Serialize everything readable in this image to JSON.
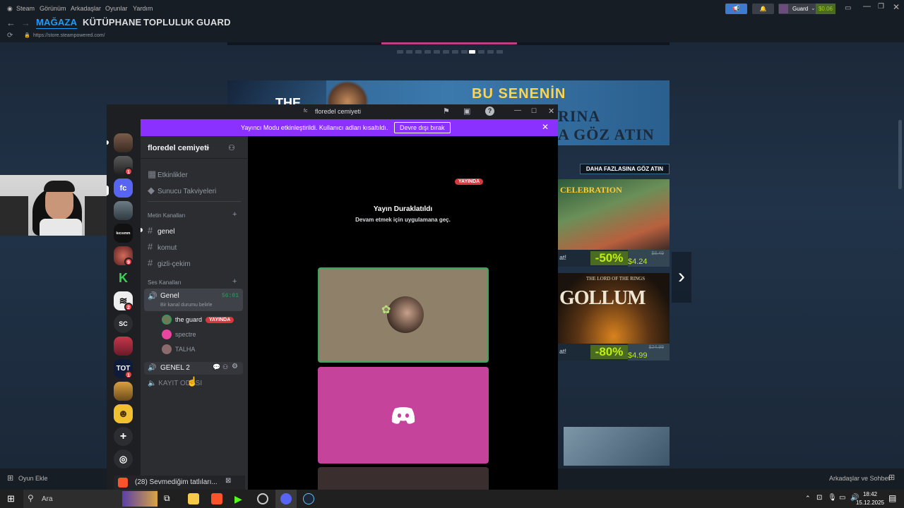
{
  "steam": {
    "menu": [
      "Steam",
      "Görünüm",
      "Arkadaşlar",
      "Oyunlar",
      "Yardım"
    ],
    "user_name": "Guard",
    "wallet": "$0.06",
    "tabs": [
      "MAĞAZA",
      "KÜTÜPHANE",
      "TOPLULUK",
      "GUARD"
    ],
    "url": "https://store.steampowered.com/",
    "banner_line1": "BU SENENİN",
    "banner_line2": "RINA",
    "banner_line3": "A GÖZ ATIN",
    "banner_left": "THE",
    "more_button": "DAHA FAZLASINA GÖZ ATIN",
    "cards": [
      {
        "title": "CELEBRATION",
        "label": "at!",
        "discount": "-50%",
        "old_price": "$8.49",
        "new_price": "$4.24 USD"
      },
      {
        "title": "GOLLUM",
        "label": "at!",
        "discount": "-80%",
        "old_price": "$24.99",
        "new_price": "$4.99 USD",
        "subtitle": "THE LORD OF THE RINGS"
      }
    ],
    "add_game": "Oyun Ekle",
    "friends_chat": "Arkadaşlar ve Sohbet"
  },
  "discord": {
    "window_title": "floredel cemiyeti",
    "banner_text": "Yayıncı Modu etkinleştirildi. Kullanıcı adları kısaltıldı.",
    "banner_button": "Devre dışı bırak",
    "server_name": "floredel cemiyeti",
    "servers": [
      {
        "name": "fc",
        "badge": ""
      },
      {
        "name": "SC",
        "badge": ""
      }
    ],
    "server_badges": [
      "1",
      "9",
      "2",
      "1"
    ],
    "top_items": [
      "Etkinlikler",
      "Sunucu Takviyeleri"
    ],
    "text_category": "Metin Kanalları",
    "text_channels": [
      "genel",
      "komut",
      "gizli-çekim"
    ],
    "voice_category": "Ses Kanalları",
    "voice_channels": [
      {
        "name": "Genel",
        "timer": "56:01",
        "status": "Bir kanal durumu belirle"
      },
      {
        "name": "GENEL 2"
      },
      {
        "name": "KAYIT ODASI"
      }
    ],
    "voice_users": [
      {
        "name": "the guard",
        "live": "YAYINDA"
      },
      {
        "name": "spectre"
      },
      {
        "name": "TALHA"
      }
    ],
    "stream_live": "YAYINDA",
    "stream_paused_title": "Yayın Duraklatıldı",
    "stream_paused_sub": "Devam etmek için uygulamana geç.",
    "activity": "(28) Sevmediğim tatlıları..."
  },
  "taskbar": {
    "search": "Ara",
    "time": "18:42",
    "date": "15.12.2025"
  },
  "colors": {
    "steam_accent": "#1a9fff",
    "discord_blurple": "#5865f2",
    "streamer_banner": "#8a31ff",
    "discount_green": "#beee11"
  }
}
